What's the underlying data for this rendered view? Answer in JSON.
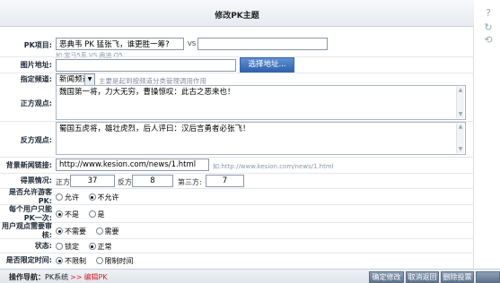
{
  "title": "修改PK主题",
  "pk_item": {
    "label": "PK项目:",
    "left_value": "恶典韦 PK 猛张飞，谁更胜一筹?",
    "vs": "VS",
    "right_value": "",
    "hint": "如:宝马5系 VS 奥迪 Q5"
  },
  "image_url": {
    "label": "图片地址:",
    "value": "",
    "button": "选择地址..."
  },
  "channel": {
    "label": "指定频道:",
    "selected": "新闻频道",
    "hint": "主要是起到按频道分类管理调用作用"
  },
  "pro_view": {
    "label": "正方观点:",
    "text": "魏国第一将，力大无穷，曹操惊叹：此古之恶来也！"
  },
  "con_view": {
    "label": "反方观点:",
    "text": "蜀国五虎将，雄壮虎烈，后人评曰：汉后言勇者必张飞！"
  },
  "news_link": {
    "label": "背景新闻链接:",
    "value": "http://www.kesion.com/news/1.html",
    "hint": "如:http://www.kesion.com/news/1.html"
  },
  "votes": {
    "label": "得票情况:",
    "pro_label": "正方:",
    "pro_value": "37",
    "con_label": "反方:",
    "con_value": "8",
    "third_label": "第三方:",
    "third_value": "7"
  },
  "allow_guest": {
    "label": "是否允许游客PK:",
    "options": [
      "允许",
      "不允许"
    ],
    "selected": 1
  },
  "once_per_user": {
    "label": "每个用户只能PK一次:",
    "options": [
      "不是",
      "是"
    ],
    "selected": 0
  },
  "need_review": {
    "label": "用户观点需要审核:",
    "options": [
      "不需要",
      "需要"
    ],
    "selected": 0
  },
  "status": {
    "label": "状态:",
    "options": [
      "锁定",
      "正常"
    ],
    "selected": 1
  },
  "time_limit": {
    "label": "是否限定时间:",
    "options": [
      "不限制",
      "限制时间"
    ],
    "selected": 0
  },
  "footer": {
    "nav_label": "操作导航：",
    "nav_system": "PK系统",
    "nav_arrow": ">>",
    "nav_current": "编辑PK",
    "btn_confirm": "确定修改",
    "btn_cancel": "取消返回",
    "btn_extra": "删除投票"
  },
  "side_icons": [
    "question-icon",
    "refresh-icon",
    "recycle-icon"
  ]
}
